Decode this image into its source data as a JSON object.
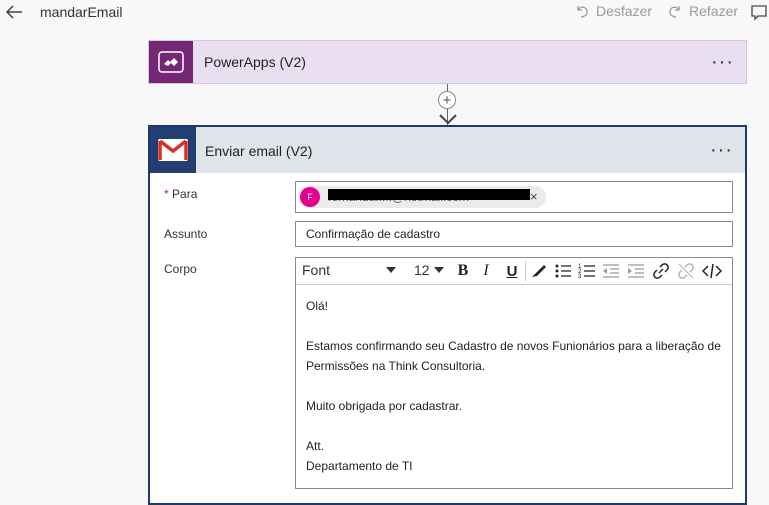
{
  "header": {
    "flow_name": "mandarEmail",
    "undo_label": "Desfazer",
    "redo_label": "Refazer"
  },
  "trigger": {
    "title": "PowerApps (V2)",
    "menu": "···"
  },
  "connector": {
    "plus": "+"
  },
  "action": {
    "title": "Enviar email (V2)",
    "menu": "···",
    "to": {
      "label": "Para",
      "required_mark": "*",
      "chip_avatar": "F",
      "chip_text": "fernanda.....@hotmail.com",
      "chip_remove": "×"
    },
    "subject": {
      "label": "Assunto",
      "value": "Confirmação de cadastro"
    },
    "body": {
      "label": "Corpo",
      "font": "Font",
      "size": "12",
      "lines": {
        "greeting": "Olá!",
        "line1": "Estamos confirmando seu Cadastro de novos Funionários para a liberação de",
        "line2": "Permissões na Think Consultoria.",
        "line3": "Muito obrigada por cadastrar.",
        "line4": "Att.",
        "line5": "Departamento de TI"
      }
    }
  },
  "colors": {
    "powerapps": "#742774",
    "gmail_header": "#223e72",
    "avatar": "#e3008c"
  }
}
